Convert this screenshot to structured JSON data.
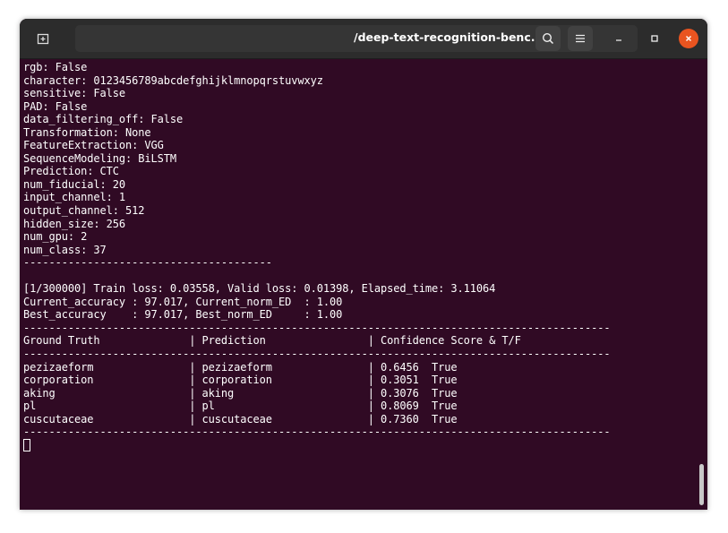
{
  "window": {
    "title": "/deep-text-recognition-benc..."
  },
  "terminal": {
    "lines": [
      "rgb: False",
      "character: 0123456789abcdefghijklmnopqrstuvwxyz",
      "sensitive: False",
      "PAD: False",
      "data_filtering_off: False",
      "Transformation: None",
      "FeatureExtraction: VGG",
      "SequenceModeling: BiLSTM",
      "Prediction: CTC",
      "num_fiducial: 20",
      "input_channel: 1",
      "output_channel: 512",
      "hidden_size: 256",
      "num_gpu: 2",
      "num_class: 37",
      "---------------------------------------",
      "",
      "[1/300000] Train loss: 0.03558, Valid loss: 0.01398, Elapsed_time: 3.11064",
      "Current_accuracy : 97.017, Current_norm_ED  : 1.00",
      "Best_accuracy    : 97.017, Best_norm_ED     : 1.00",
      "--------------------------------------------------------------------------------------------",
      "Ground Truth              | Prediction                | Confidence Score & T/F",
      "--------------------------------------------------------------------------------------------",
      "pezizaeform               | pezizaeform               | 0.6456  True",
      "corporation               | corporation               | 0.3051  True",
      "aking                     | aking                     | 0.3076  True",
      "pl                        | pl                        | 0.8069  True",
      "cuscutaceae               | cuscutaceae               | 0.7360  True",
      "--------------------------------------------------------------------------------------------"
    ]
  },
  "icons": {
    "new_tab": "new-tab-icon",
    "search": "search-icon",
    "menu": "hamburger-menu-icon",
    "minimize": "minimize-icon",
    "maximize": "maximize-icon",
    "close": "close-icon"
  },
  "colors": {
    "terminal_bg": "#300a24",
    "titlebar_bg": "#2c2c2c",
    "close_accent": "#e95420"
  }
}
